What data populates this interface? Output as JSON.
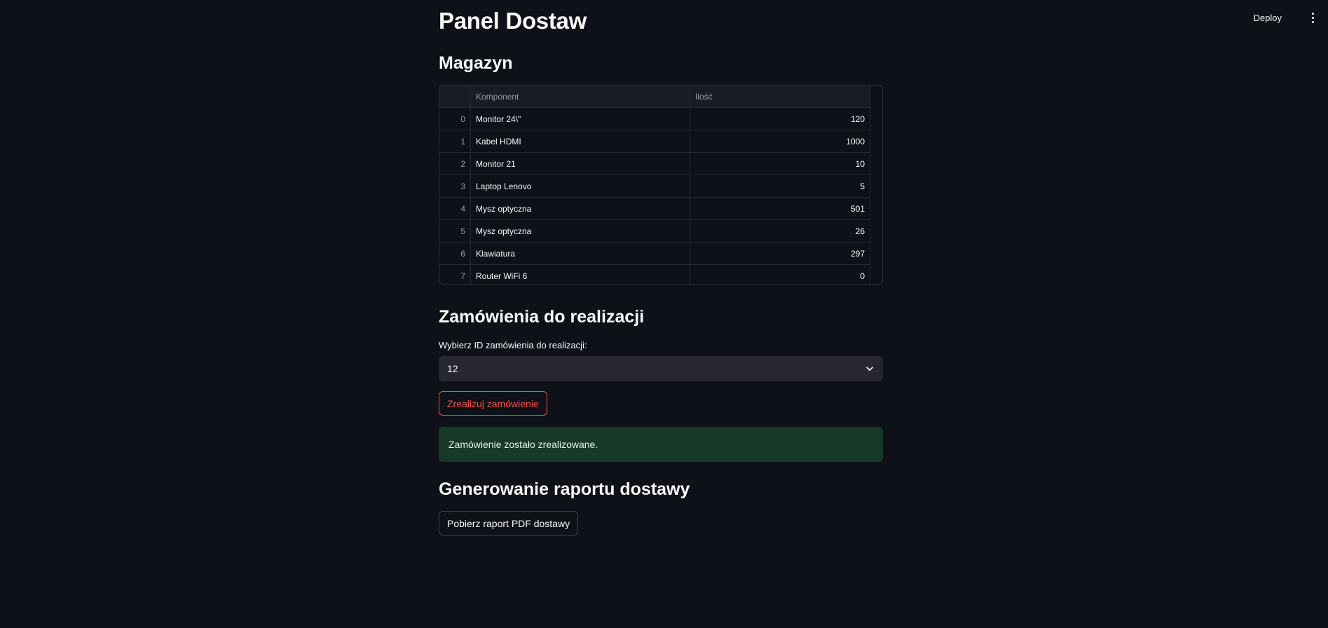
{
  "header": {
    "deploy_label": "Deploy",
    "menu_icon": "more-vertical-icon"
  },
  "page": {
    "title": "Panel Dostaw"
  },
  "warehouse": {
    "heading": "Magazyn",
    "columns": [
      "",
      "Komponent",
      "Ilość"
    ],
    "rows": [
      {
        "index": "0",
        "component": "Monitor 24\\\"",
        "qty": "120"
      },
      {
        "index": "1",
        "component": "Kabel HDMI",
        "qty": "1000"
      },
      {
        "index": "2",
        "component": "Monitor 21",
        "qty": "10"
      },
      {
        "index": "3",
        "component": "Laptop Lenovo",
        "qty": "5"
      },
      {
        "index": "4",
        "component": "Mysz optyczna",
        "qty": "501"
      },
      {
        "index": "5",
        "component": "Mysz optyczna",
        "qty": "26"
      },
      {
        "index": "6",
        "component": "Klawiatura",
        "qty": "297"
      },
      {
        "index": "7",
        "component": "Router WiFi 6",
        "qty": "0"
      }
    ]
  },
  "orders": {
    "heading": "Zamówienia do realizacji",
    "select_label": "Wybierz ID zamówienia do realizacji:",
    "selected_value": "12",
    "submit_label": "Zrealizuj zamówienie",
    "success_message": "Zamówienie zostało zrealizowane."
  },
  "report": {
    "heading": "Generowanie raportu dostawy",
    "download_label": "Pobierz raport PDF dostawy"
  },
  "colors": {
    "background": "#0e1117",
    "accent": "#ff4b4b",
    "success_bg": "#173928"
  }
}
